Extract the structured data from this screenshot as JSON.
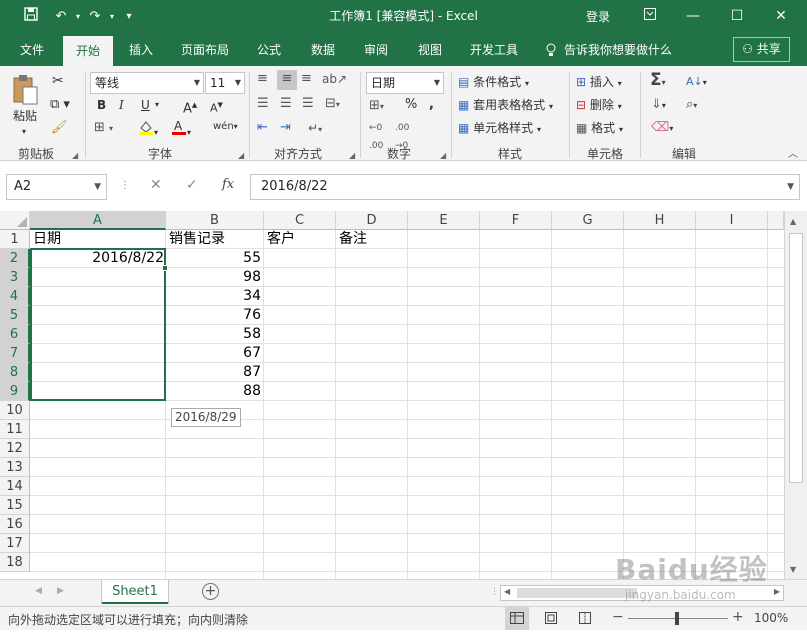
{
  "titlebar": {
    "title": "工作簿1  [兼容模式] - Excel",
    "login": "登录",
    "qat_more": "▾"
  },
  "ribbon_tabs": [
    "文件",
    "开始",
    "插入",
    "页面布局",
    "公式",
    "数据",
    "审阅",
    "视图",
    "开发工具"
  ],
  "tell_me": "告诉我你想要做什么",
  "share": "共享",
  "clipboard": {
    "paste": "粘贴",
    "group": "剪贴板"
  },
  "font": {
    "name": "等线",
    "size": "11",
    "group": "字体",
    "bold": "B",
    "italic": "I",
    "underline": "U"
  },
  "alignment": {
    "group": "对齐方式"
  },
  "number": {
    "format": "日期",
    "group": "数字",
    "percent": "%"
  },
  "styles": {
    "conditional": "条件格式",
    "table": "套用表格格式",
    "cell": "单元格样式",
    "group": "样式"
  },
  "cells": {
    "insert": "插入",
    "delete": "删除",
    "format": "格式",
    "group": "单元格"
  },
  "editing": {
    "group": "编辑"
  },
  "formula_bar": {
    "namebox": "A2",
    "formula": "2016/8/22",
    "fx": "fx"
  },
  "columns": [
    "A",
    "B",
    "C",
    "D",
    "E",
    "F",
    "G",
    "H",
    "I"
  ],
  "rows": [
    "1",
    "2",
    "3",
    "4",
    "5",
    "6",
    "7",
    "8",
    "9",
    "10",
    "11",
    "12",
    "13",
    "14",
    "15",
    "16",
    "17",
    "18"
  ],
  "cells_data": {
    "A1": "日期",
    "B1": "销售记录",
    "C1": "客户",
    "D1": "备注",
    "A2": "2016/8/22",
    "B2": "55",
    "B3": "98",
    "B4": "34",
    "B5": "76",
    "B6": "58",
    "B7": "67",
    "B8": "87",
    "B9": "88"
  },
  "fill_tooltip": "2016/8/29",
  "sheet_tab": "Sheet1",
  "status_text": "向外拖动选定区域可以进行填充；向内则清除",
  "zoom": "100%",
  "watermark": "Baidu经验",
  "watermark_url": "jingyan.baidu.com"
}
